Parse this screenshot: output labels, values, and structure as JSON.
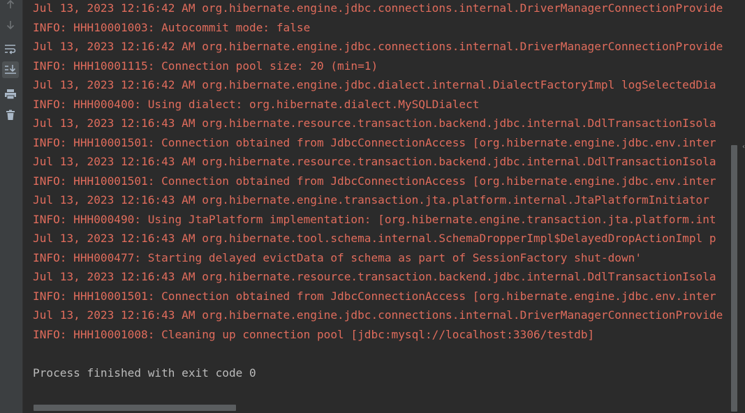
{
  "toolbar": {
    "buttons": [
      {
        "icon": "arrow-up-icon",
        "active": false
      },
      {
        "icon": "arrow-down-icon",
        "active": false
      },
      {
        "icon": "soft-wrap-icon",
        "active": false
      },
      {
        "icon": "scroll-to-end-icon",
        "active": true
      },
      {
        "icon": "print-icon",
        "active": false
      },
      {
        "icon": "trash-icon",
        "active": false
      }
    ]
  },
  "console": {
    "lines": [
      {
        "text": "Jul 13, 2023 12:16:42 AM org.hibernate.engine.jdbc.connections.internal.DriverManagerConnectionProvide",
        "kind": "error"
      },
      {
        "text": "INFO: HHH10001003: Autocommit mode: false",
        "kind": "error"
      },
      {
        "text": "Jul 13, 2023 12:16:42 AM org.hibernate.engine.jdbc.connections.internal.DriverManagerConnectionProvide",
        "kind": "error"
      },
      {
        "text": "INFO: HHH10001115: Connection pool size: 20 (min=1)",
        "kind": "error"
      },
      {
        "text": "Jul 13, 2023 12:16:42 AM org.hibernate.engine.jdbc.dialect.internal.DialectFactoryImpl logSelectedDia",
        "kind": "error"
      },
      {
        "text": "INFO: HHH000400: Using dialect: org.hibernate.dialect.MySQLDialect",
        "kind": "error"
      },
      {
        "text": "Jul 13, 2023 12:16:43 AM org.hibernate.resource.transaction.backend.jdbc.internal.DdlTransactionIsola",
        "kind": "error"
      },
      {
        "text": "INFO: HHH10001501: Connection obtained from JdbcConnectionAccess [org.hibernate.engine.jdbc.env.inter",
        "kind": "error"
      },
      {
        "text": "Jul 13, 2023 12:16:43 AM org.hibernate.resource.transaction.backend.jdbc.internal.DdlTransactionIsola",
        "kind": "error"
      },
      {
        "text": "INFO: HHH10001501: Connection obtained from JdbcConnectionAccess [org.hibernate.engine.jdbc.env.inter",
        "kind": "error"
      },
      {
        "text": "Jul 13, 2023 12:16:43 AM org.hibernate.engine.transaction.jta.platform.internal.JtaPlatformInitiator",
        "kind": "error"
      },
      {
        "text": "INFO: HHH000490: Using JtaPlatform implementation: [org.hibernate.engine.transaction.jta.platform.int",
        "kind": "error"
      },
      {
        "text": "Jul 13, 2023 12:16:43 AM org.hibernate.tool.schema.internal.SchemaDropperImpl$DelayedDropActionImpl p",
        "kind": "error"
      },
      {
        "text": "INFO: HHH000477: Starting delayed evictData of schema as part of SessionFactory shut-down'",
        "kind": "error"
      },
      {
        "text": "Jul 13, 2023 12:16:43 AM org.hibernate.resource.transaction.backend.jdbc.internal.DdlTransactionIsola",
        "kind": "error"
      },
      {
        "text": "INFO: HHH10001501: Connection obtained from JdbcConnectionAccess [org.hibernate.engine.jdbc.env.inter",
        "kind": "error"
      },
      {
        "text": "Jul 13, 2023 12:16:43 AM org.hibernate.engine.jdbc.connections.internal.DriverManagerConnectionProvide",
        "kind": "error"
      },
      {
        "text": "INFO: HHH10001008: Cleaning up connection pool [jdbc:mysql://localhost:3306/testdb]",
        "kind": "error"
      },
      {
        "text": "",
        "kind": "blank"
      },
      {
        "text": "Process finished with exit code 0",
        "kind": "normal"
      }
    ]
  },
  "colors": {
    "error_text": "#e06c5c",
    "normal_text": "#bbbbbb",
    "background": "#2b2b2b",
    "toolbar": "#3c3f41"
  }
}
